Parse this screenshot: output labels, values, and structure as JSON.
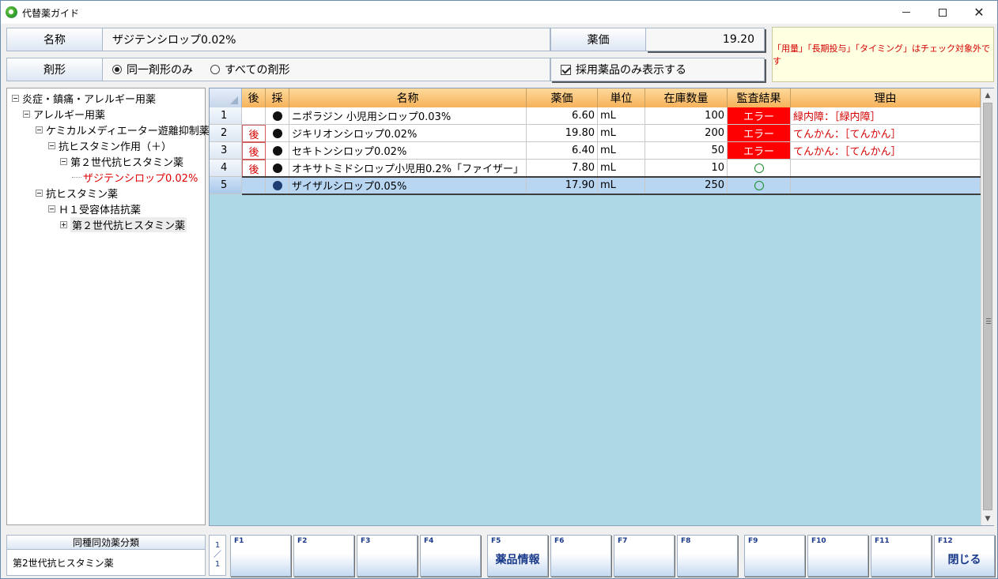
{
  "window": {
    "title": "代替薬ガイド",
    "controls": {
      "minimize": "—",
      "maximize": "☐",
      "close": "✕"
    }
  },
  "form": {
    "name_label": "名称",
    "name_value": "ザジテンシロップ0.02%",
    "price_label": "薬価",
    "price_value": "19.20",
    "form_label": "剤形",
    "radio_same": "同一剤形のみ",
    "radio_all": "すべての剤形",
    "radio_selected": "same",
    "adopted_only": "採用薬品のみ表示する",
    "adopted_only_checked": true
  },
  "notice": "「用量」「長期投与」「タイミング」はチェック対象外です",
  "tree": [
    {
      "label": "炎症・鎮痛・アレルギー用薬",
      "level": 0,
      "toggle": "minus"
    },
    {
      "label": "アレルギー用薬",
      "level": 1,
      "toggle": "minus"
    },
    {
      "label": "ケミカルメディエーター遊離抑制薬",
      "level": 2,
      "toggle": "minus"
    },
    {
      "label": "抗ヒスタミン作用（＋）",
      "level": 3,
      "toggle": "minus"
    },
    {
      "label": "第２世代抗ヒスタミン薬",
      "level": 4,
      "toggle": "minus"
    },
    {
      "label": "ザジテンシロップ0.02%",
      "level": 5,
      "toggle": "leaf",
      "selected": true
    },
    {
      "label": "抗ヒスタミン薬",
      "level": 2,
      "toggle": "minus"
    },
    {
      "label": "Ｈ１受容体拮抗薬",
      "level": 3,
      "toggle": "minus"
    },
    {
      "label": "第２世代抗ヒスタミン薬",
      "level": 4,
      "toggle": "plus",
      "highlight": true
    }
  ],
  "grid": {
    "headers": [
      "後",
      "採",
      "名称",
      "薬価",
      "単位",
      "在庫数量",
      "監査結果",
      "理由"
    ],
    "rows": [
      {
        "no": "1",
        "late": "",
        "adopted": true,
        "name": "ニポラジン 小児用シロップ0.03%",
        "price": "6.60",
        "unit": "mL",
        "stock": "100",
        "result": "エラー",
        "result_type": "error",
        "reason": "緑内障：［緑内障］"
      },
      {
        "no": "2",
        "late": "後",
        "adopted": true,
        "name": "ジキリオンシロップ0.02%",
        "price": "19.80",
        "unit": "mL",
        "stock": "200",
        "result": "エラー",
        "result_type": "error",
        "reason": "てんかん：［てんかん］"
      },
      {
        "no": "3",
        "late": "後",
        "adopted": true,
        "name": "セキトンシロップ0.02%",
        "price": "6.40",
        "unit": "mL",
        "stock": "50",
        "result": "エラー",
        "result_type": "error",
        "reason": "てんかん：［てんかん］"
      },
      {
        "no": "4",
        "late": "後",
        "adopted": true,
        "name": "オキサトミドシロップ小児用0.2%「ファイザー」",
        "price": "7.80",
        "unit": "mL",
        "stock": "10",
        "result": "",
        "result_type": "ok",
        "reason": ""
      },
      {
        "no": "5",
        "late": "",
        "adopted": true,
        "name": "ザイザルシロップ0.05%",
        "price": "17.90",
        "unit": "mL",
        "stock": "250",
        "result": "",
        "result_type": "ok",
        "reason": "",
        "selected": true
      }
    ]
  },
  "category": {
    "label": "同種同効薬分類",
    "value": "第2世代抗ヒスタミン薬"
  },
  "pager": {
    "current": "1",
    "sep": "／",
    "total": "1"
  },
  "fkeys": [
    {
      "num": "F1",
      "label": ""
    },
    {
      "num": "F2",
      "label": ""
    },
    {
      "num": "F3",
      "label": ""
    },
    {
      "num": "F4",
      "label": ""
    },
    {
      "num": "F5",
      "label": "薬品情報"
    },
    {
      "num": "F6",
      "label": ""
    },
    {
      "num": "F7",
      "label": ""
    },
    {
      "num": "F8",
      "label": ""
    },
    {
      "num": "F9",
      "label": ""
    },
    {
      "num": "F10",
      "label": ""
    },
    {
      "num": "F11",
      "label": ""
    },
    {
      "num": "F12",
      "label": "閉じる"
    }
  ]
}
